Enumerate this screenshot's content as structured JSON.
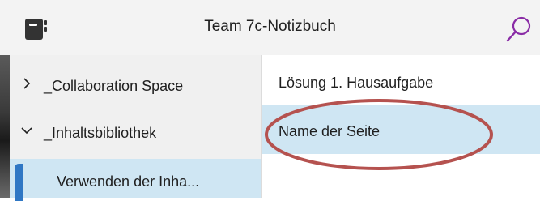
{
  "header": {
    "title": "Team 7c-Notizbuch",
    "notebook_icon": "notebook-icon",
    "search_icon": "search-icon"
  },
  "sections": {
    "items": [
      {
        "label": "_Collaboration Space",
        "expanded": false,
        "chevron": "chevron-right-icon"
      },
      {
        "label": "_Inhaltsbibliothek",
        "expanded": true,
        "chevron": "chevron-down-icon"
      }
    ],
    "sub_item": {
      "label": "Verwenden der Inha...",
      "selected": true
    }
  },
  "pages": {
    "items": [
      {
        "label": "Lösung 1. Hausaufgabe",
        "selected": false
      },
      {
        "label": "Name der Seite",
        "selected": true
      }
    ]
  },
  "colors": {
    "header_bg": "#f3f3f3",
    "selection": "#cfe6f3",
    "section_tab": "#2f77c4",
    "search_accent": "#8a2ca6",
    "annotation": "#b5524f"
  }
}
